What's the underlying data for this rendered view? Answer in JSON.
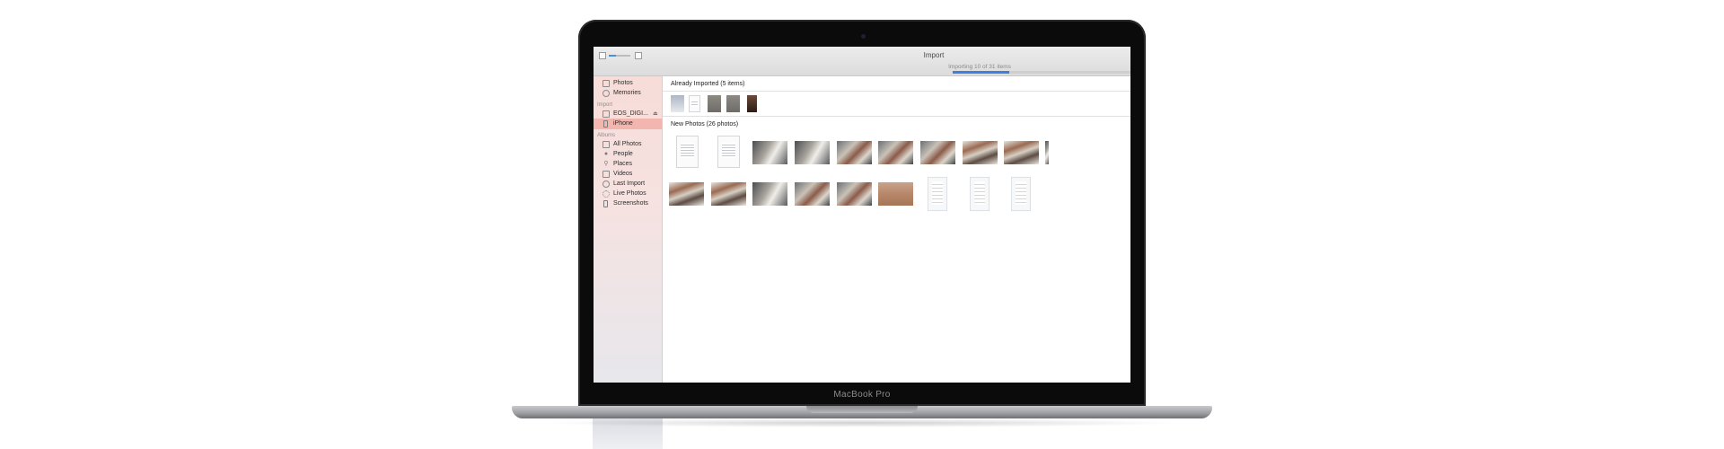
{
  "device": {
    "model_label": "MacBook Pro"
  },
  "window": {
    "title": "Import",
    "progress_text": "Importing 10 of 31 items",
    "progress_fraction": 0.32
  },
  "sidebar": {
    "items_top": [
      {
        "label": "Photos",
        "icon": "photos-icon"
      },
      {
        "label": "Memories",
        "icon": "memories-icon"
      }
    ],
    "import_header": "Import",
    "import_items": [
      {
        "label": "EOS_DIGI...",
        "icon": "camera-card-icon",
        "eject": "⏏"
      },
      {
        "label": "iPhone",
        "icon": "iphone-icon",
        "selected": true
      }
    ],
    "albums_header": "Albums",
    "album_items": [
      {
        "label": "All Photos",
        "icon": "all-photos-icon"
      },
      {
        "label": "People",
        "icon": "people-icon"
      },
      {
        "label": "Places",
        "icon": "places-icon"
      },
      {
        "label": "Videos",
        "icon": "videos-icon"
      },
      {
        "label": "Last Import",
        "icon": "last-import-icon"
      },
      {
        "label": "Live Photos",
        "icon": "live-photos-icon"
      },
      {
        "label": "Screenshots",
        "icon": "screenshots-icon"
      }
    ]
  },
  "content": {
    "already_imported_title": "Already Imported (5 items)",
    "new_photos_title": "New Photos (26 photos)"
  },
  "colors": {
    "accent": "#3d7fe0",
    "sidebar_selected": "#f2b6ae",
    "sidebar_tint": "#f7dcd8"
  }
}
